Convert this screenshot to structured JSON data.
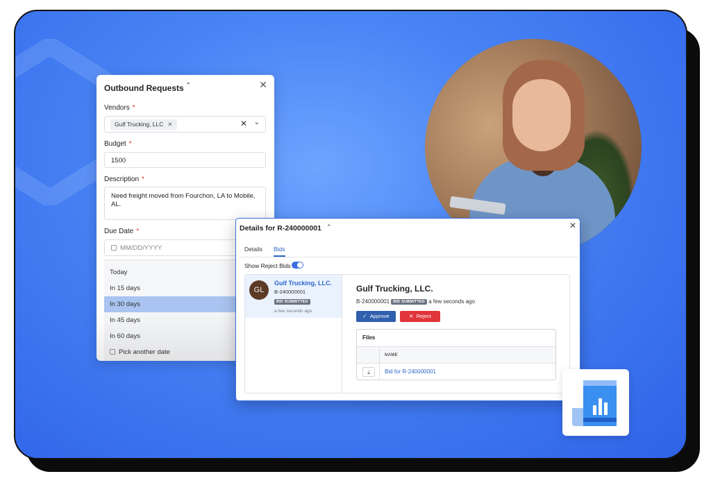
{
  "outbound": {
    "title": "Outbound Requests",
    "vendors_label": "Vendors",
    "vendor_chip": "Gulf Trucking, LLC",
    "budget_label": "Budget",
    "budget_value": "1500",
    "description_label": "Description",
    "description_value": "Need freight moved from Fourchon, LA to Mobile, AL.",
    "due_date_label": "Due Date",
    "due_date_placeholder": "MM/DD/YYYY",
    "required_mark": "*",
    "options": [
      "Today",
      "In 15 days",
      "In 30 days",
      "In 45 days",
      "In 60 days",
      "Pick another date"
    ],
    "selected_option": "In 30 days"
  },
  "details": {
    "title": "Details for R-240000001",
    "tabs": [
      "Details",
      "Bids"
    ],
    "active_tab": "Bids",
    "show_reject_label": "Show Reject Bids",
    "show_reject_on": true,
    "bid": {
      "initials": "GL",
      "name": "Gulf Trucking, LLC.",
      "id": "B-240000001",
      "status": "BID SUBMITTED",
      "time": "a few seconds ago"
    },
    "detail_name": "Gulf Trucking, LLC.",
    "detail_id": "B-240000001",
    "detail_time": "a few seconds ago",
    "approve_label": "Approve",
    "reject_label": "Reject",
    "files_header": "Files",
    "files_col": "NAME",
    "file_name": "Bid for R-240000001"
  },
  "colors": {
    "background": "#3b73ee",
    "accent": "#2b66c9",
    "approve": "#2f5fad",
    "reject": "#e0353a",
    "selected_option": "#a9c4f0"
  }
}
